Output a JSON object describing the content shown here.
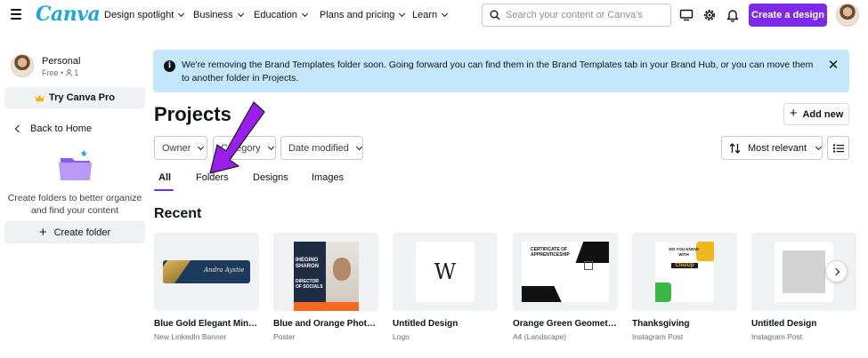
{
  "topbar": {
    "logo": "Canva",
    "nav": [
      {
        "label": "Design spotlight"
      },
      {
        "label": "Business"
      },
      {
        "label": "Education"
      },
      {
        "label": "Plans and pricing"
      },
      {
        "label": "Learn"
      }
    ],
    "search_placeholder": "Search your content or Canva's",
    "icons": [
      "desktop-icon",
      "gear-icon",
      "bell-icon"
    ],
    "create_label": "Create a design",
    "brand_color": "#7d2ae8"
  },
  "sidebar": {
    "profile_name": "Personal",
    "profile_plan": "Free • ",
    "profile_members": "1",
    "try_pro_label": "Try Canva Pro",
    "back_label": "Back to Home",
    "folder_caption": "Create folders to better organize and find your content",
    "create_folder_label": "Create folder"
  },
  "banner": {
    "text": "We're removing the Brand Templates folder soon. Going forward you can find them in the Brand Templates tab in your Brand Hub, or you can move them to another folder in Projects.",
    "background": "#c4e7fb"
  },
  "main": {
    "title": "Projects",
    "add_new_label": "Add new",
    "filters": [
      {
        "label": "Owner"
      },
      {
        "label": "Category"
      },
      {
        "label": "Date modified"
      }
    ],
    "sort_label": "Most relevant",
    "tabs": [
      {
        "label": "All",
        "active": true
      },
      {
        "label": "Folders",
        "active": false
      },
      {
        "label": "Designs",
        "active": false
      },
      {
        "label": "Images",
        "active": false
      }
    ],
    "recent_title": "Recent",
    "cards": [
      {
        "title": "Blue Gold Elegant Minim...",
        "sub": "New LinkedIn Banner",
        "thumb_text": "Andra Aystie"
      },
      {
        "title": "Blue and Orange Photo C...",
        "sub": "Poster",
        "thumb_text": "IHEGINO SHARON",
        "thumb_text2": "DIRECTOR OF SOCIALS"
      },
      {
        "title": "Untitled Design",
        "sub": "Logo",
        "thumb_text": "W"
      },
      {
        "title": "Orange Green Geometric ...",
        "sub": "A4 (Landscape)",
        "thumb_text": "CERTIFICATE OF APPRENTICESHIP"
      },
      {
        "title": "Thanksgiving",
        "sub": "Instagram Post",
        "thumb_text": "DO YOU KNOW WITH",
        "thumb_text2": "ChisUp"
      },
      {
        "title": "Untitled Design",
        "sub": "Instagram Post"
      }
    ]
  },
  "annotation": {
    "arrow_color": "#9b1fe8"
  }
}
